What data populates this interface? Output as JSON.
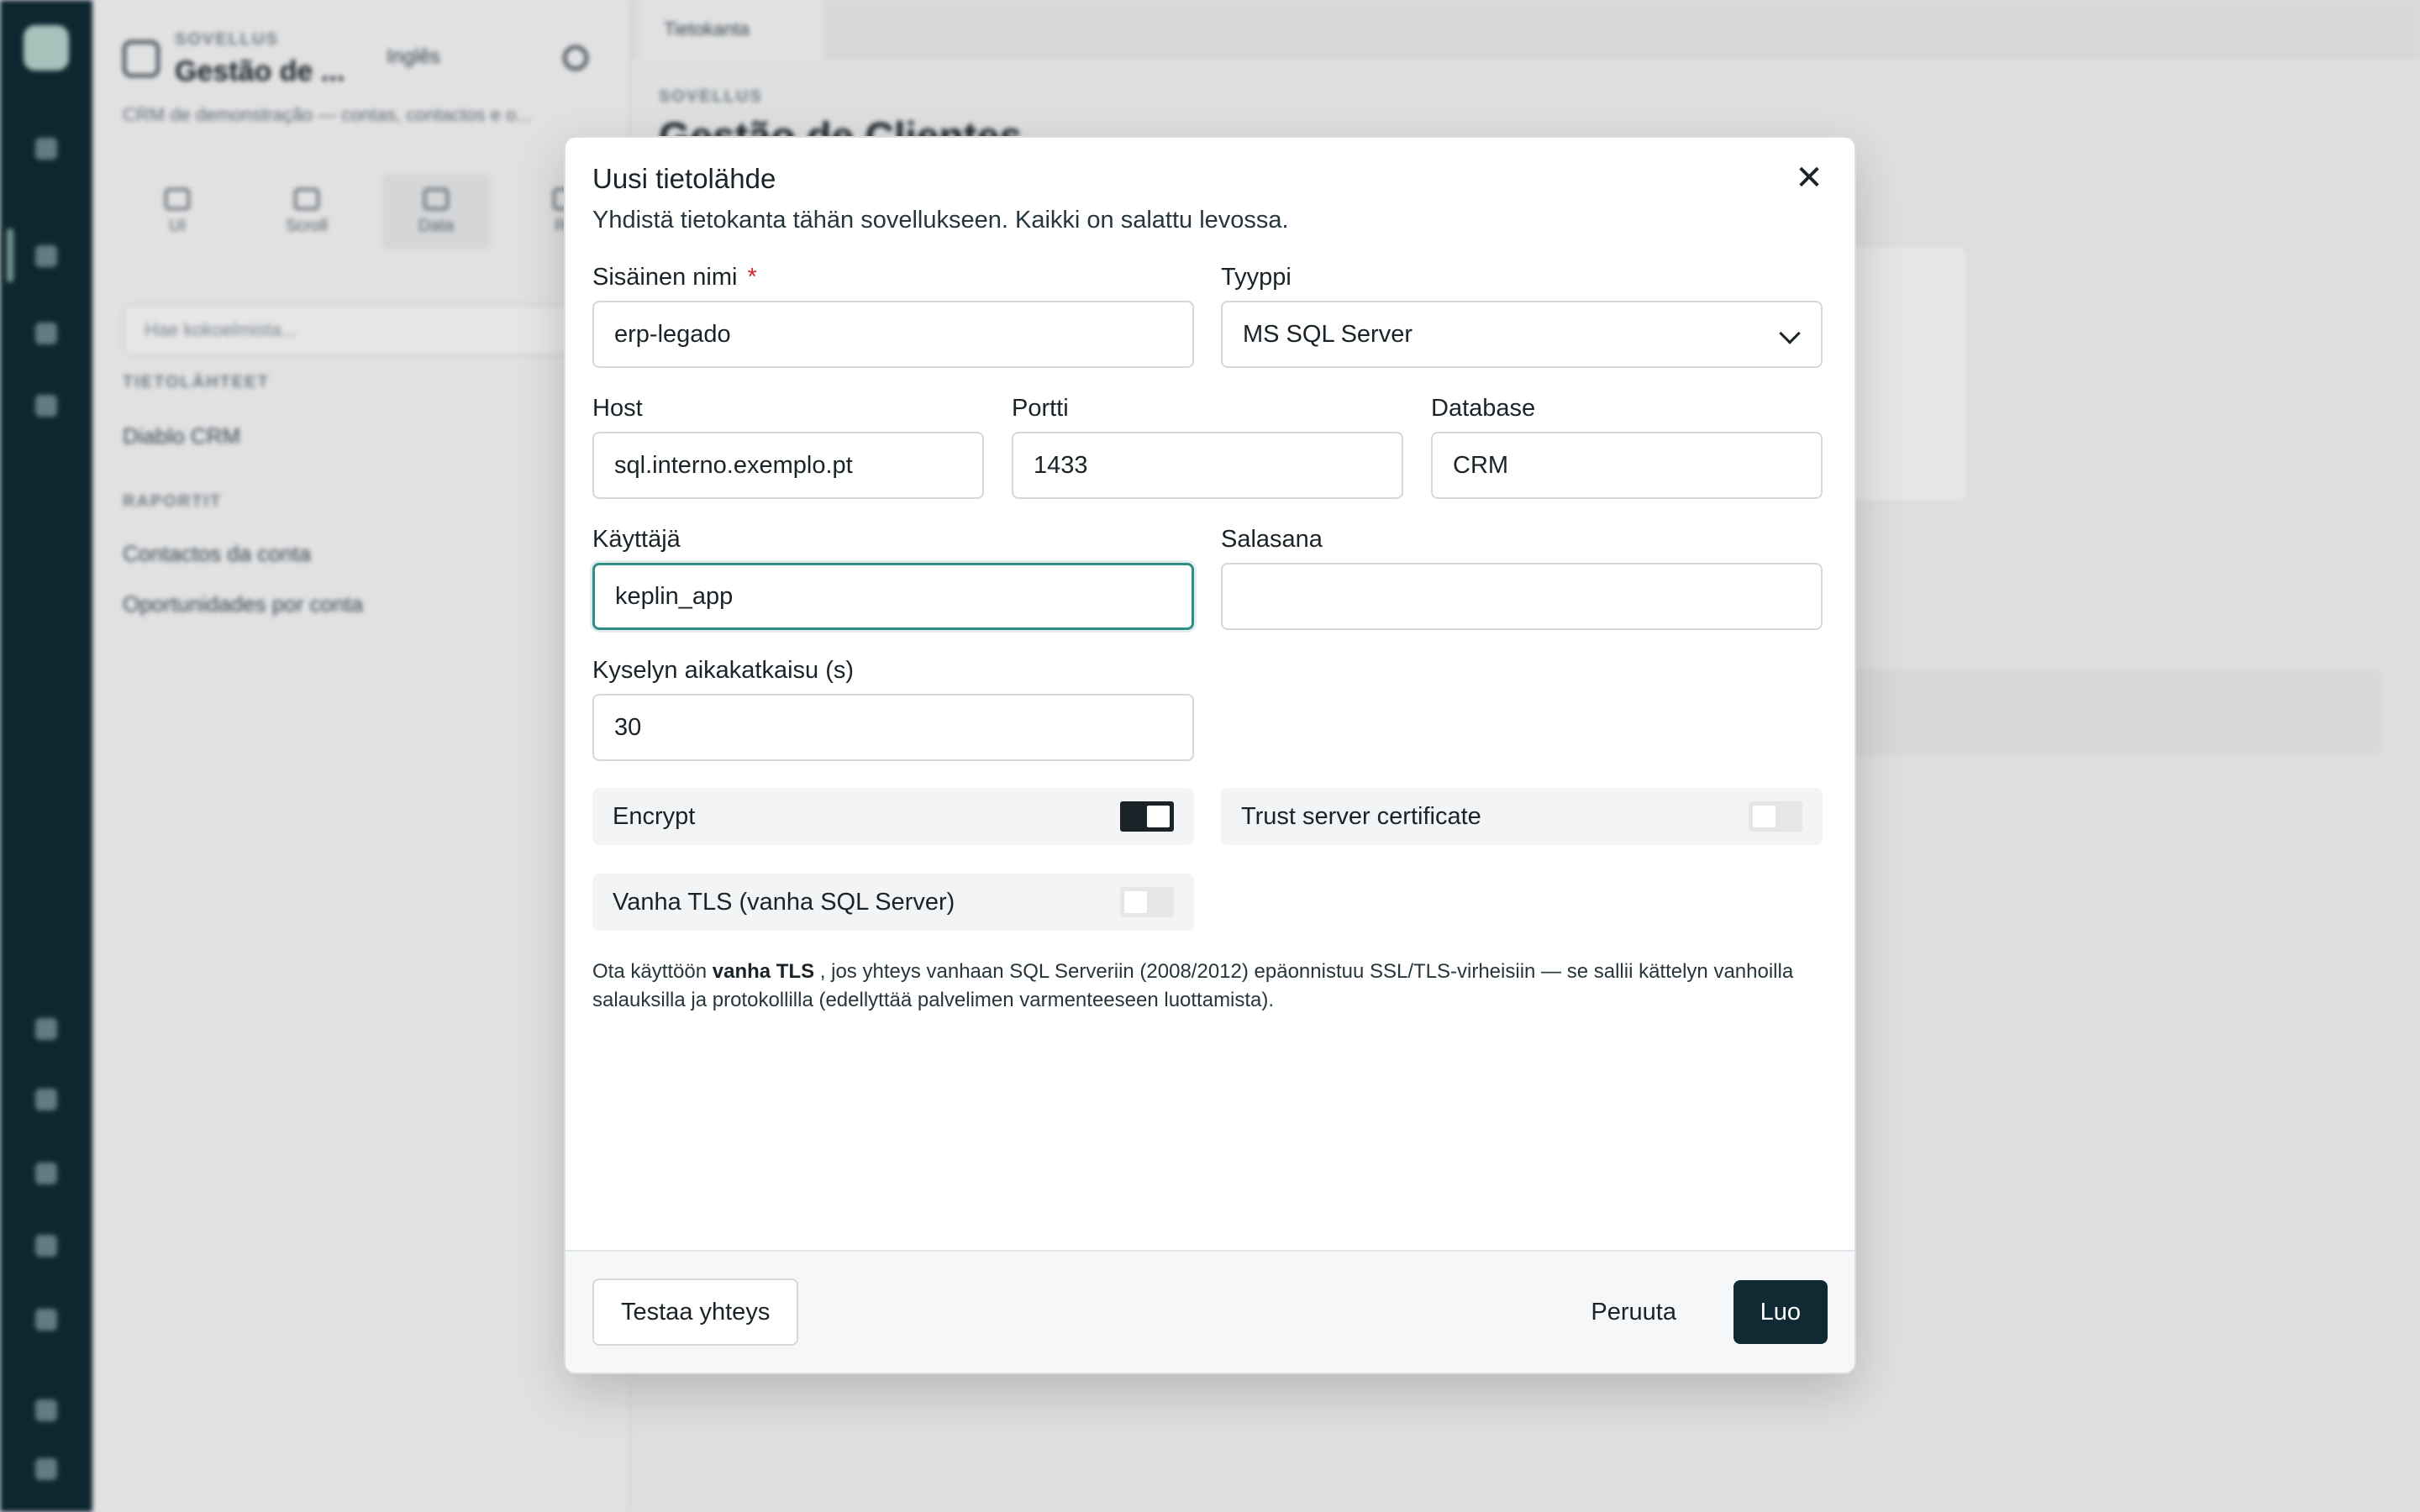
{
  "modal": {
    "title": "Uusi tietolähde",
    "subtitle": "Yhdistä tietokanta tähän sovellukseen. Kaikki on salattu levossa.",
    "close_icon": "close-icon",
    "fields": {
      "internal_name": {
        "label": "Sisäinen nimi",
        "required_mark": "*",
        "value": "erp-legado"
      },
      "type": {
        "label": "Tyyppi",
        "value": "MS SQL Server"
      },
      "host": {
        "label": "Host",
        "value": "sql.interno.exemplo.pt"
      },
      "port": {
        "label": "Portti",
        "value": "1433"
      },
      "database": {
        "label": "Database",
        "value": "CRM"
      },
      "user": {
        "label": "Käyttäjä",
        "value": "keplin_app"
      },
      "password": {
        "label": "Salasana",
        "value": ""
      },
      "timeout": {
        "label": "Kyselyn aikakatkaisu (s)",
        "value": "30"
      }
    },
    "toggles": {
      "encrypt": {
        "label": "Encrypt",
        "on": true
      },
      "trust_cert": {
        "label": "Trust server certificate",
        "on": false
      },
      "legacy_tls": {
        "label": "Vanha TLS (vanha SQL Server)",
        "on": false
      }
    },
    "help": {
      "prefix": "Ota käyttöön",
      "bold": "vanha TLS",
      "suffix": ", jos yhteys vanhaan SQL Serveriin (2008/2012) epäonnistuu SSL/TLS-virheisiin — se sallii kättelyn vanhoilla salauksilla ja protokollilla (edellyttää palvelimen varmenteeseen luottamista)."
    },
    "footer": {
      "test": "Testaa yhteys",
      "cancel": "Peruuta",
      "create": "Luo"
    }
  },
  "background": {
    "kicker": "SOVELLUS",
    "app_title": "Gestão de ...",
    "env": "Inglês",
    "description": "CRM de demonstração — contas, contactos e o...",
    "tabs": [
      "UI",
      "Scroll",
      "Data",
      "Re"
    ],
    "search_placeholder": "Hae kokoelmista...",
    "section_datasources": "TIETOLÄHTEET",
    "datasource_item": "Diablo CRM",
    "section_reports": "RAPORTIT",
    "reports": [
      "Contactos da conta",
      "Oportunidades por conta"
    ],
    "open_tab": "Tietokanta",
    "main_kicker": "SOVELLUS",
    "main_title": "Gestão de Clientes"
  },
  "colors": {
    "primary": "#0f2a33",
    "focus": "#2f8f86",
    "required": "#d9262c"
  }
}
